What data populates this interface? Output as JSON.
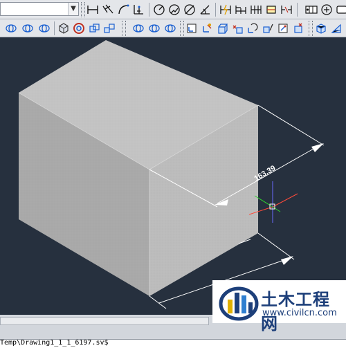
{
  "toolbar_top": {
    "combo_value": "",
    "buttons": [
      "linear-dimension",
      "aligned-dimension",
      "arc-length-dimension",
      "ordinate-dimension",
      "radius-dimension",
      "jogged-dimension",
      "diameter-dimension",
      "angular-dimension",
      "quick-dimension",
      "baseline-dimension",
      "continue-dimension",
      "dimension-space",
      "dimension-break",
      "tolerance",
      "center-mark"
    ]
  },
  "toolbar_modeling": {
    "buttons": [
      "orbit",
      "free-orbit",
      "continuous-orbit",
      "view-cube",
      "steering-wheel",
      "pan-3d",
      "zoom-3d",
      "ucs-icon",
      "ucs-object",
      "ucs-face",
      "ucs-view",
      "ucs-origin",
      "ucs-zaxis",
      "ucs-3point",
      "ucs-x",
      "ucs-y",
      "ucs-z",
      "box",
      "wedge"
    ]
  },
  "drawing": {
    "dimension_text": "163.39",
    "colors": {
      "background": "#26303e",
      "top_face": "#c4c4c4",
      "front_face": "#a9a9a9",
      "right_face": "#bdbdbd",
      "dimension": "#ffffff"
    }
  },
  "command_line": {
    "text": "Temp\\Drawing1_1_1_6197.sv$"
  },
  "watermark": {
    "title": "土木工程网",
    "url": "www.civilcn.com"
  }
}
